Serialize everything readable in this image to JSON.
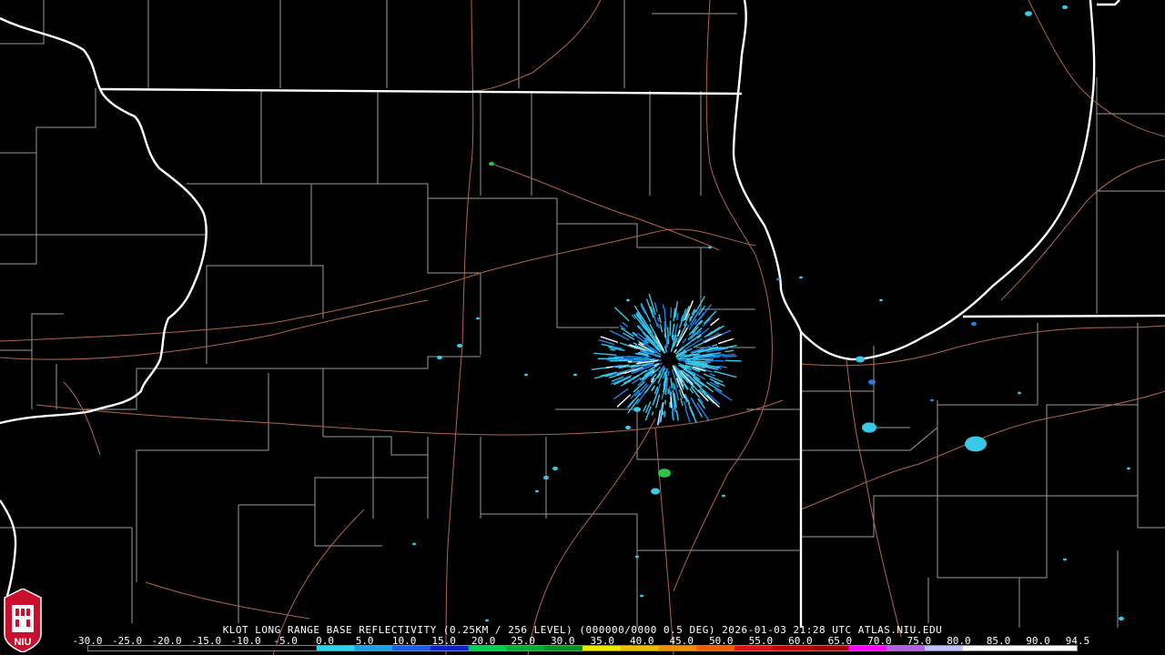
{
  "product": {
    "caption": "KLOT LONG RANGE BASE REFLECTIVITY (0.25KM / 256 LEVEL) (000000/0000 0.5 DEG) 2026-01-03 21:28 UTC  ATLAS.NIU.EDU"
  },
  "logo": {
    "text": "NIU"
  },
  "colorbar": {
    "ticks": [
      "-30.0",
      "-25.0",
      "-20.0",
      "-15.0",
      "-10.0",
      "-5.0",
      "0.0",
      "5.0",
      "10.0",
      "15.0",
      "20.0",
      "25.0",
      "30.0",
      "35.0",
      "40.0",
      "45.0",
      "50.0",
      "55.0",
      "60.0",
      "65.0",
      "70.0",
      "75.0",
      "80.0",
      "85.0",
      "90.0",
      "94.5"
    ],
    "colors": [
      "#000000",
      "#000000",
      "#000000",
      "#000000",
      "#000000",
      "#000000",
      "#2ad4e6",
      "#1ea0e8",
      "#1e5ae8",
      "#1020c8",
      "#00d050",
      "#00b030",
      "#009020",
      "#e8e800",
      "#e8c000",
      "#f09000",
      "#f06000",
      "#e01010",
      "#c00000",
      "#a00000",
      "#ff00ff",
      "#b060e0",
      "#c0c0ff",
      "#ffffff",
      "#ffffff",
      "#ffffff"
    ]
  },
  "map_colors": {
    "state_border": "#ffffff",
    "county_border": "#9a9a9a",
    "highway": "#b0664a",
    "echo_light": "#39c8e6",
    "echo_mid": "#1e82e6",
    "echo_green": "#2ac24a"
  }
}
